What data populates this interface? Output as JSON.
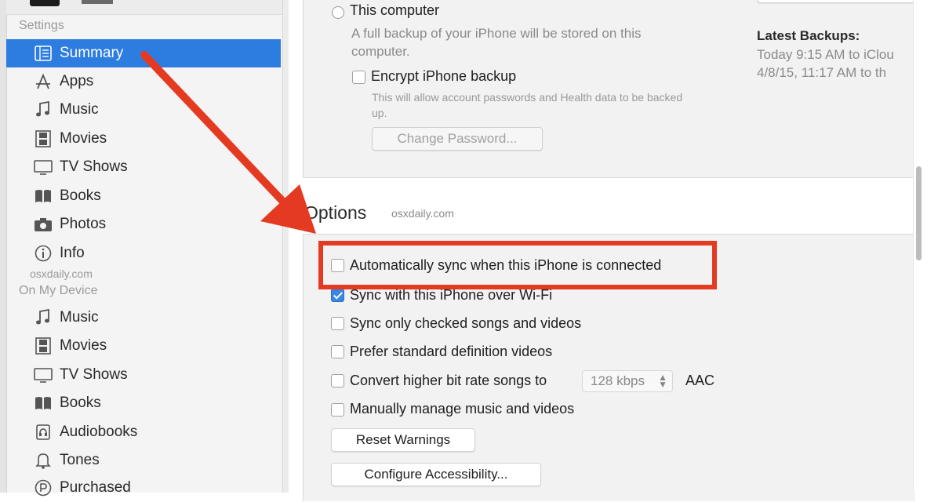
{
  "sidebar": {
    "settings_heading": "Settings",
    "settings_items": [
      {
        "label": "Summary",
        "icon": "summary-icon",
        "selected": true
      },
      {
        "label": "Apps",
        "icon": "apps-icon"
      },
      {
        "label": "Music",
        "icon": "music-note-icon"
      },
      {
        "label": "Movies",
        "icon": "film-icon"
      },
      {
        "label": "TV Shows",
        "icon": "tv-icon"
      },
      {
        "label": "Books",
        "icon": "book-icon"
      },
      {
        "label": "Photos",
        "icon": "camera-icon"
      },
      {
        "label": "Info",
        "icon": "info-icon"
      }
    ],
    "watermark": "osxdaily.com",
    "device_heading": "On My Device",
    "device_items": [
      {
        "label": "Music",
        "icon": "music-note-icon"
      },
      {
        "label": "Movies",
        "icon": "film-icon"
      },
      {
        "label": "TV Shows",
        "icon": "tv-icon"
      },
      {
        "label": "Books",
        "icon": "book-icon"
      },
      {
        "label": "Audiobooks",
        "icon": "audiobook-icon"
      },
      {
        "label": "Tones",
        "icon": "bell-icon"
      },
      {
        "label": "Purchased",
        "icon": "purchased-icon"
      }
    ]
  },
  "backups": {
    "this_computer_label": "This computer",
    "this_computer_desc_1": "A full backup of your iPhone will be stored on this",
    "this_computer_desc_2": "computer.",
    "encrypt_label": "Encrypt iPhone backup",
    "encrypt_desc_1": "This will allow account passwords and Health data to be backed",
    "encrypt_desc_2": "up.",
    "change_password_button": "Change Password...",
    "latest_heading": "Latest Backups:",
    "latest_1": "Today 9:15 AM to iClou",
    "latest_2": "4/8/15, 11:17 AM to th"
  },
  "options": {
    "title": "Options",
    "watermark": "osxdaily.com",
    "auto_sync_label": "Automatically sync when this iPhone is connected",
    "wifi_sync_label": "Sync with this iPhone over Wi-Fi",
    "checked_only_label": "Sync only checked songs and videos",
    "prefer_sd_label": "Prefer standard definition videos",
    "convert_label": "Convert higher bit rate songs to",
    "bitrate_value": "128 kbps",
    "format_label": "AAC",
    "manual_label": "Manually manage music and videos",
    "reset_warnings_button": "Reset Warnings",
    "accessibility_button": "Configure Accessibility..."
  },
  "colors": {
    "selection_blue": "#2d7de0",
    "annotation_red": "#e53a22",
    "checkbox_blue": "#3a86e8"
  }
}
